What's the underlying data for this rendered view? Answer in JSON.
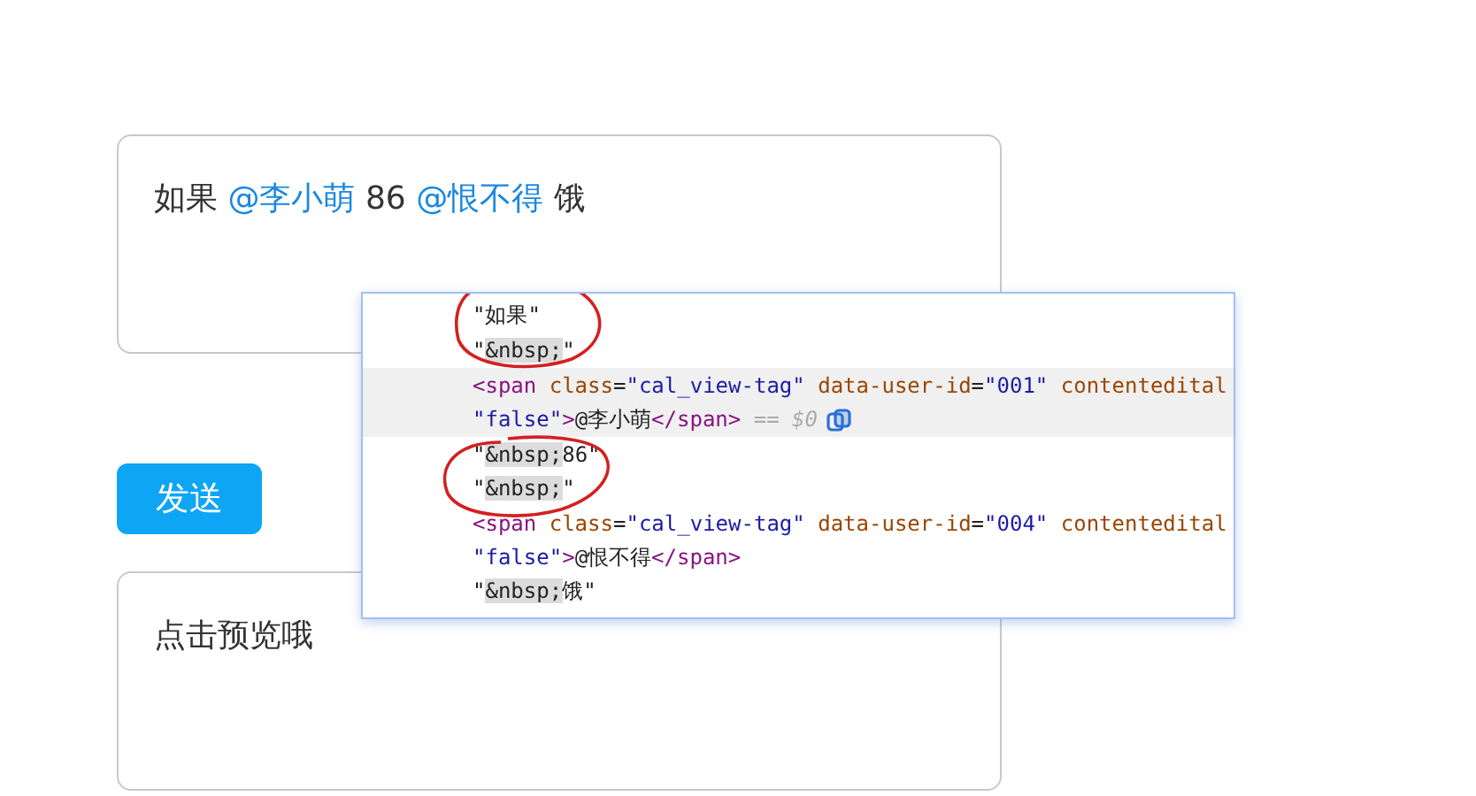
{
  "editor": {
    "segments": [
      {
        "kind": "text",
        "text": "如果"
      },
      {
        "kind": "mention",
        "text": "@李小萌"
      },
      {
        "kind": "text",
        "text": "86"
      },
      {
        "kind": "mention",
        "text": "@恨不得"
      },
      {
        "kind": "text",
        "text": "饿"
      }
    ]
  },
  "send_button": {
    "label": "发送"
  },
  "preview": {
    "text": "点击预览哦"
  },
  "devtools": {
    "lines": [
      {
        "selected": false,
        "tokens": [
          {
            "kind": "text",
            "text": "\"如果\""
          }
        ]
      },
      {
        "selected": false,
        "tokens": [
          {
            "kind": "text",
            "text": "\""
          },
          {
            "kind": "entity",
            "text": "&nbsp;"
          },
          {
            "kind": "text",
            "text": "\""
          }
        ]
      },
      {
        "selected": true,
        "tokens": [
          {
            "kind": "tag",
            "text": "<span"
          },
          {
            "kind": "attr",
            "text": " class"
          },
          {
            "kind": "punct",
            "text": "="
          },
          {
            "kind": "value",
            "text": "\"cal_view-tag\""
          },
          {
            "kind": "attr",
            "text": " data-user-id"
          },
          {
            "kind": "punct",
            "text": "="
          },
          {
            "kind": "value",
            "text": "\"001\""
          },
          {
            "kind": "attr",
            "text": " contentedital"
          }
        ]
      },
      {
        "selected": true,
        "tokens": [
          {
            "kind": "value",
            "text": "\"false\""
          },
          {
            "kind": "tag",
            "text": ">"
          },
          {
            "kind": "text",
            "text": "@李小萌"
          },
          {
            "kind": "tag",
            "text": "</span>"
          },
          {
            "kind": "dim",
            "text": " == $0"
          }
        ]
      },
      {
        "selected": false,
        "tokens": [
          {
            "kind": "text",
            "text": "\""
          },
          {
            "kind": "entity",
            "text": "&nbsp;"
          },
          {
            "kind": "text",
            "text": "86\""
          }
        ]
      },
      {
        "selected": false,
        "tokens": [
          {
            "kind": "text",
            "text": "\""
          },
          {
            "kind": "entity",
            "text": "&nbsp;"
          },
          {
            "kind": "text",
            "text": "\""
          }
        ]
      },
      {
        "selected": false,
        "tokens": [
          {
            "kind": "tag",
            "text": "<span"
          },
          {
            "kind": "attr",
            "text": " class"
          },
          {
            "kind": "punct",
            "text": "="
          },
          {
            "kind": "value",
            "text": "\"cal_view-tag\""
          },
          {
            "kind": "attr",
            "text": " data-user-id"
          },
          {
            "kind": "punct",
            "text": "="
          },
          {
            "kind": "value",
            "text": "\"004\""
          },
          {
            "kind": "attr",
            "text": " contentedital"
          }
        ]
      },
      {
        "selected": false,
        "tokens": [
          {
            "kind": "value",
            "text": "\"false\""
          },
          {
            "kind": "tag",
            "text": ">"
          },
          {
            "kind": "text",
            "text": "@恨不得"
          },
          {
            "kind": "tag",
            "text": "</span>"
          }
        ]
      },
      {
        "selected": false,
        "tokens": [
          {
            "kind": "text",
            "text": "\""
          },
          {
            "kind": "entity",
            "text": "&nbsp;"
          },
          {
            "kind": "text",
            "text": "饿\""
          }
        ]
      }
    ]
  }
}
